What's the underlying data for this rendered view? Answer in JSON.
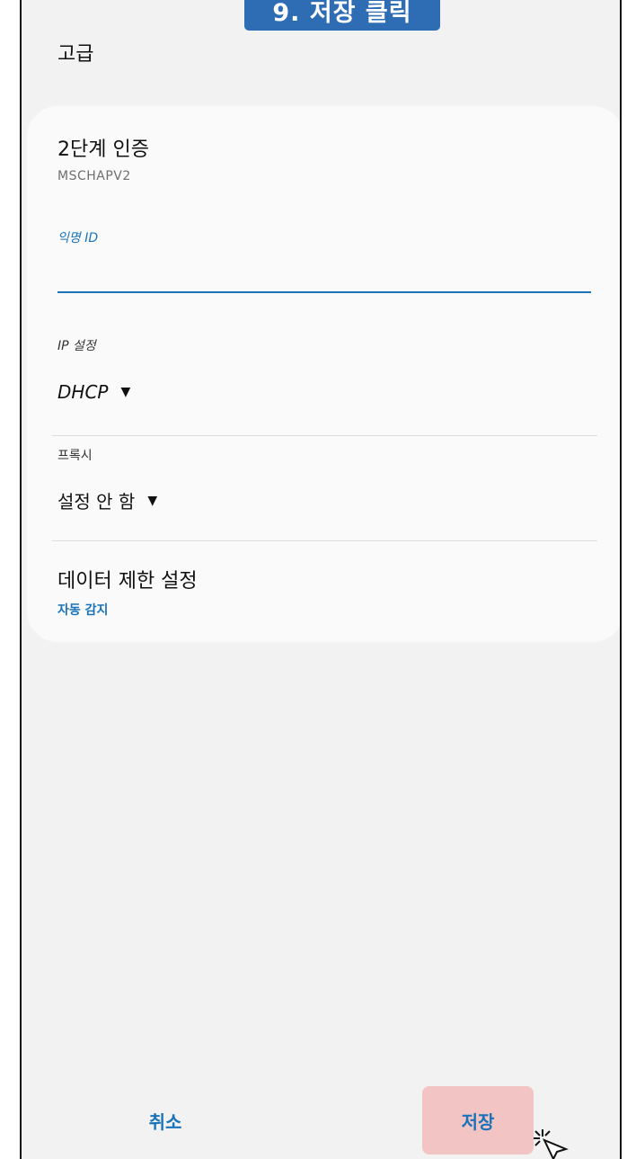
{
  "banner": {
    "text": "9. 저장 클릭"
  },
  "header": {
    "title": "고급"
  },
  "card": {
    "two_factor": {
      "title": "2단계 인증",
      "value": "MSCHAPV2"
    },
    "anonymous_id": {
      "label": "익명 ID",
      "value": ""
    },
    "ip_settings": {
      "label": "IP 설정",
      "value": "DHCP"
    },
    "proxy": {
      "label": "프록시",
      "value": "설정 안 함"
    },
    "data_limit": {
      "title": "데이터 제한 설정",
      "value": "자동 감지"
    }
  },
  "buttons": {
    "cancel": "취소",
    "save": "저장"
  },
  "icons": {
    "dropdown": "dropdown-arrow-icon",
    "cursor": "click-cursor-icon"
  },
  "colors": {
    "accent": "#1a73b8",
    "banner": "#2e6db4",
    "save_highlight": "#f3c4c4"
  }
}
